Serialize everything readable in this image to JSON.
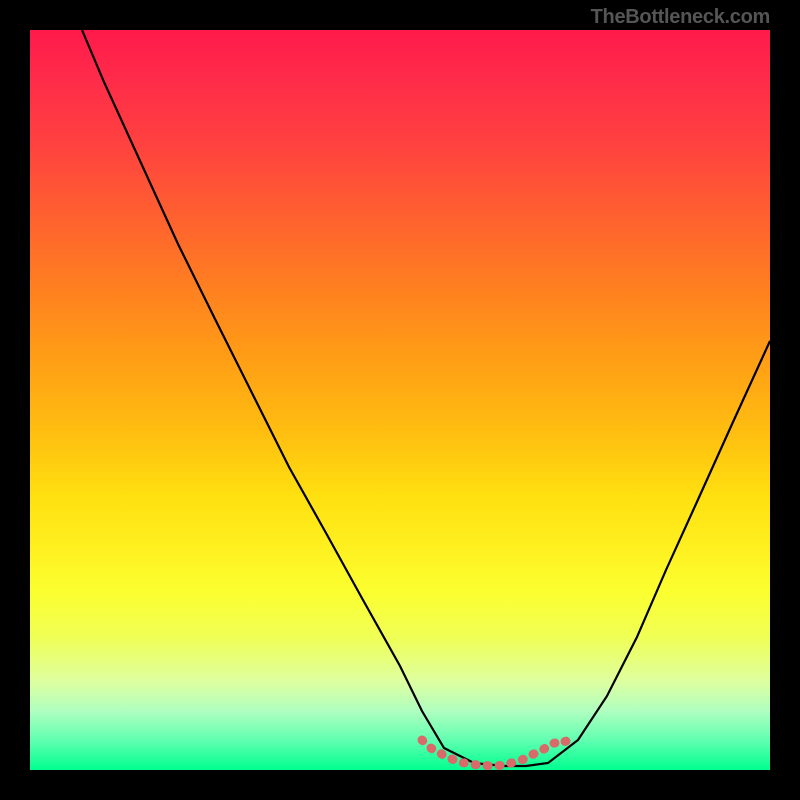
{
  "attribution": "TheBottleneck.com",
  "chart_data": {
    "type": "line",
    "title": "",
    "xlabel": "",
    "ylabel": "",
    "xlim": [
      0,
      100
    ],
    "ylim": [
      0,
      100
    ],
    "background": "rainbow-gradient-red-to-green",
    "series": [
      {
        "name": "bottleneck-curve",
        "color": "#000000",
        "x": [
          7,
          10,
          15,
          20,
          25,
          30,
          35,
          40,
          45,
          50,
          53,
          56,
          60,
          64,
          67,
          70,
          74,
          78,
          82,
          86,
          90,
          95,
          100
        ],
        "values": [
          100,
          93,
          82,
          71,
          61,
          51,
          41,
          32,
          23,
          14,
          8,
          3,
          1,
          0.5,
          0.5,
          1,
          4,
          10,
          18,
          27,
          36,
          47,
          58
        ]
      },
      {
        "name": "optimal-zone-marker",
        "color": "#d86a6a",
        "x": [
          53,
          55,
          57,
          59,
          61,
          63,
          65,
          67,
          69,
          71,
          73
        ],
        "values": [
          4.0,
          2.5,
          1.5,
          1.0,
          0.7,
          0.6,
          0.7,
          1.0,
          1.6,
          2.5,
          4.0
        ]
      }
    ],
    "gradient_stops": [
      {
        "pos": 0,
        "color": "#ff1a4b"
      },
      {
        "pos": 15,
        "color": "#ff4040"
      },
      {
        "pos": 35,
        "color": "#ff8020"
      },
      {
        "pos": 55,
        "color": "#ffc010"
      },
      {
        "pos": 75,
        "color": "#fbff30"
      },
      {
        "pos": 92,
        "color": "#b0ffc0"
      },
      {
        "pos": 100,
        "color": "#00ff90"
      }
    ]
  }
}
